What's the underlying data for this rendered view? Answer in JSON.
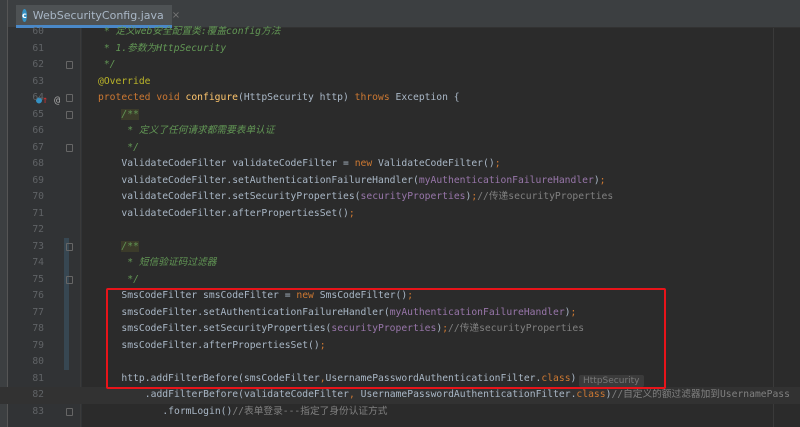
{
  "tab": {
    "title": "WebSecurityConfig.java",
    "icon": "c",
    "close": "×"
  },
  "inlay_hint": "HttpSecurity",
  "lines": [
    {
      "n": "60",
      "indent": 1,
      "t": [
        {
          "c": "doc",
          "s": "* 定义web安全配置类:覆盖config方法"
        }
      ]
    },
    {
      "n": "61",
      "indent": 1,
      "t": [
        {
          "c": "doc",
          "s": "* 1.参数为HttpSecurity"
        }
      ]
    },
    {
      "n": "62",
      "indent": 1,
      "fold": true,
      "t": [
        {
          "c": "doc",
          "s": "*/"
        }
      ]
    },
    {
      "n": "63",
      "indent": 0,
      "t": [
        {
          "c": "ann",
          "s": "@Override"
        }
      ]
    },
    {
      "n": "64",
      "indent": 0,
      "fold": true,
      "t": [
        {
          "c": "kw",
          "s": "protected void "
        },
        {
          "c": "mth",
          "s": "configure"
        },
        {
          "c": "pl",
          "s": "(HttpSecurity http) "
        },
        {
          "c": "kw",
          "s": "throws "
        },
        {
          "c": "pl",
          "s": "Exception {"
        }
      ]
    },
    {
      "n": "65",
      "indent": 4,
      "fold": true,
      "t": [
        {
          "c": "doc dochl",
          "s": "/**"
        }
      ]
    },
    {
      "n": "66",
      "indent": 5,
      "t": [
        {
          "c": "doc",
          "s": "* 定义了任何请求都需要表单认证"
        }
      ]
    },
    {
      "n": "67",
      "indent": 5,
      "fold": true,
      "t": [
        {
          "c": "doc",
          "s": "*/"
        }
      ]
    },
    {
      "n": "68",
      "indent": 4,
      "t": [
        {
          "c": "pl",
          "s": "ValidateCodeFilter validateCodeFilter = "
        },
        {
          "c": "kw",
          "s": "new "
        },
        {
          "c": "pl",
          "s": "ValidateCodeFilter()"
        },
        {
          "c": "kw",
          "s": ";"
        }
      ]
    },
    {
      "n": "69",
      "indent": 4,
      "t": [
        {
          "c": "pl",
          "s": "validateCodeFilter.setAuthenticationFailureHandler("
        },
        {
          "c": "fld",
          "s": "myAuthenticationFailureHandler"
        },
        {
          "c": "pl",
          "s": ")"
        },
        {
          "c": "kw",
          "s": ";"
        }
      ]
    },
    {
      "n": "70",
      "indent": 4,
      "t": [
        {
          "c": "pl",
          "s": "validateCodeFilter.setSecurityProperties("
        },
        {
          "c": "fld",
          "s": "securityProperties"
        },
        {
          "c": "pl",
          "s": ")"
        },
        {
          "c": "kw",
          "s": ";"
        },
        {
          "c": "cm",
          "s": "//传递securityProperties"
        }
      ]
    },
    {
      "n": "71",
      "indent": 4,
      "t": [
        {
          "c": "pl",
          "s": "validateCodeFilter.afterPropertiesSet()"
        },
        {
          "c": "kw",
          "s": ";"
        }
      ]
    },
    {
      "n": "72",
      "indent": 0,
      "t": []
    },
    {
      "n": "73",
      "indent": 4,
      "fold": true,
      "t": [
        {
          "c": "doc dochl",
          "s": "/**"
        }
      ]
    },
    {
      "n": "74",
      "indent": 5,
      "t": [
        {
          "c": "doc",
          "s": "* 短信验证码过滤器"
        }
      ]
    },
    {
      "n": "75",
      "indent": 5,
      "fold": true,
      "t": [
        {
          "c": "doc",
          "s": "*/"
        }
      ]
    },
    {
      "n": "76",
      "indent": 4,
      "t": [
        {
          "c": "pl",
          "s": "SmsCodeFilter smsCodeFilter = "
        },
        {
          "c": "kw",
          "s": "new "
        },
        {
          "c": "pl",
          "s": "SmsCodeFilter()"
        },
        {
          "c": "kw",
          "s": ";"
        }
      ]
    },
    {
      "n": "77",
      "indent": 4,
      "t": [
        {
          "c": "pl",
          "s": "smsCodeFilter.setAuthenticationFailureHandler("
        },
        {
          "c": "fld",
          "s": "myAuthenticationFailureHandler"
        },
        {
          "c": "pl",
          "s": ")"
        },
        {
          "c": "kw",
          "s": ";"
        }
      ]
    },
    {
      "n": "78",
      "indent": 4,
      "t": [
        {
          "c": "pl",
          "s": "smsCodeFilter.setSecurityProperties("
        },
        {
          "c": "fld",
          "s": "securityProperties"
        },
        {
          "c": "pl",
          "s": ")"
        },
        {
          "c": "kw",
          "s": ";"
        },
        {
          "c": "cm",
          "s": "//传递securityProperties"
        }
      ]
    },
    {
      "n": "79",
      "indent": 4,
      "t": [
        {
          "c": "pl",
          "s": "smsCodeFilter.afterPropertiesSet()"
        },
        {
          "c": "kw",
          "s": ";"
        }
      ]
    },
    {
      "n": "80",
      "indent": 0,
      "t": []
    },
    {
      "n": "81",
      "indent": 4,
      "t": [
        {
          "c": "pl",
          "s": "http.addFilterBefore(smsCodeFilter"
        },
        {
          "c": "kw",
          "s": ","
        },
        {
          "c": "pl",
          "s": "UsernamePasswordAuthenticationFilter."
        },
        {
          "c": "kw",
          "s": "class"
        },
        {
          "c": "pl",
          "s": ")"
        }
      ]
    },
    {
      "n": "82",
      "indent": 8,
      "cur": true,
      "t": [
        {
          "c": "pl",
          "s": ".addFilterBefore(validateCodeFilter"
        },
        {
          "c": "kw",
          "s": ", "
        },
        {
          "c": "pl",
          "s": "UsernamePasswordAuthenticationFilter."
        },
        {
          "c": "kw",
          "s": "class"
        },
        {
          "c": "pl",
          "s": ")"
        },
        {
          "c": "cm",
          "s": "//自定义的额过滤器加到UsernamePass"
        }
      ]
    },
    {
      "n": "83",
      "indent": 11,
      "fold": true,
      "t": [
        {
          "c": "pl",
          "s": ".formLogin()"
        },
        {
          "c": "cm",
          "s": "//表单登录---指定了身份认证方式"
        }
      ]
    }
  ]
}
